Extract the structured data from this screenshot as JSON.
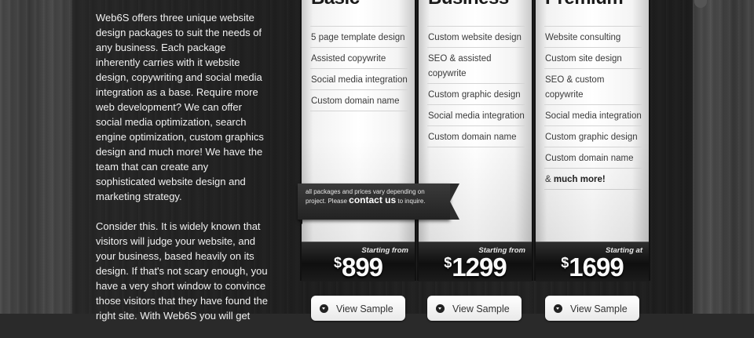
{
  "intro": {
    "paragraph1": "Web6S offers three unique website design packages to suit the needs of any business. Each package inherently carries with it website design, copywriting and social media integration as a base. Require more web development? We can offer social media optimization, search engine optimization, custom graphics design and much more! We have the team that can create any sophisticated website design and marketing strategy.",
    "paragraph2": "Consider this. It is widely known that visitors will judge your website, and your business, based heavily on its design. If that's not scary enough, you have a very short window to convince those visitors that they have found the right site. With Web6S you will get"
  },
  "packages": [
    {
      "title": "Basic",
      "features": [
        "5 page template design",
        "Assisted copywrite",
        "Social media integration",
        "Custom domain name"
      ],
      "price_label": "Starting from",
      "currency": "$",
      "price": "899",
      "button": "View Sample"
    },
    {
      "title": "Business",
      "features": [
        "Custom website design",
        "SEO & assisted copywrite",
        "Custom graphic design",
        "Social media integration",
        "Custom domain name"
      ],
      "price_label": "Starting from",
      "currency": "$",
      "price": "1299",
      "button": "View Sample"
    },
    {
      "title": "Premium",
      "features": [
        "Website consulting",
        "Custom site design",
        "SEO & custom copywrite",
        "Social media integration",
        "Custom graphic design",
        "Custom domain name"
      ],
      "extra_prefix": "& ",
      "extra_bold": "much more!",
      "price_label": "Starting at",
      "currency": "$",
      "price": "1699",
      "button": "View Sample"
    }
  ],
  "note": {
    "text_before": "all packages and prices vary depending on project. Please ",
    "link": "contact us",
    "text_after": " to inquire."
  }
}
